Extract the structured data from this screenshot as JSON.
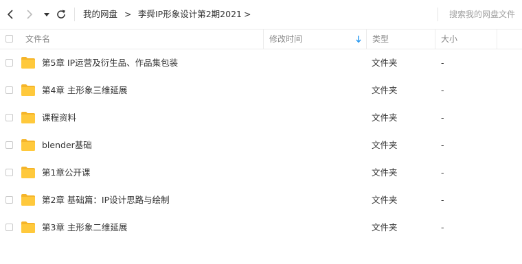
{
  "toolbar": {
    "breadcrumbs": [
      "我的网盘",
      "李舜IP形象设计第2期2021"
    ],
    "crumb_separator": ">",
    "search_placeholder": "搜索我的网盘文件"
  },
  "header": {
    "name": "文件名",
    "modified": "修改时间",
    "type": "类型",
    "size": "大小"
  },
  "files": [
    {
      "name": "第5章 IP运营及衍生品、作品集包装",
      "type": "文件夹",
      "size": "-"
    },
    {
      "name": "第4章 主形象三维延展",
      "type": "文件夹",
      "size": "-"
    },
    {
      "name": "课程资料",
      "type": "文件夹",
      "size": "-"
    },
    {
      "name": "blender基础",
      "type": "文件夹",
      "size": "-"
    },
    {
      "name": "第1章公开课",
      "type": "文件夹",
      "size": "-"
    },
    {
      "name": "第2章 基础篇：IP设计思路与绘制",
      "type": "文件夹",
      "size": "-"
    },
    {
      "name": "第3章 主形象二维延展",
      "type": "文件夹",
      "size": "-"
    }
  ],
  "colors": {
    "folder": "#ffc93c",
    "folder_tab": "#f5b52a",
    "sort_accent": "#2e9bf0"
  },
  "icons": [
    "back-arrow-icon",
    "forward-arrow-icon",
    "dropdown-caret-icon",
    "refresh-icon",
    "sort-down-icon",
    "folder-icon"
  ]
}
